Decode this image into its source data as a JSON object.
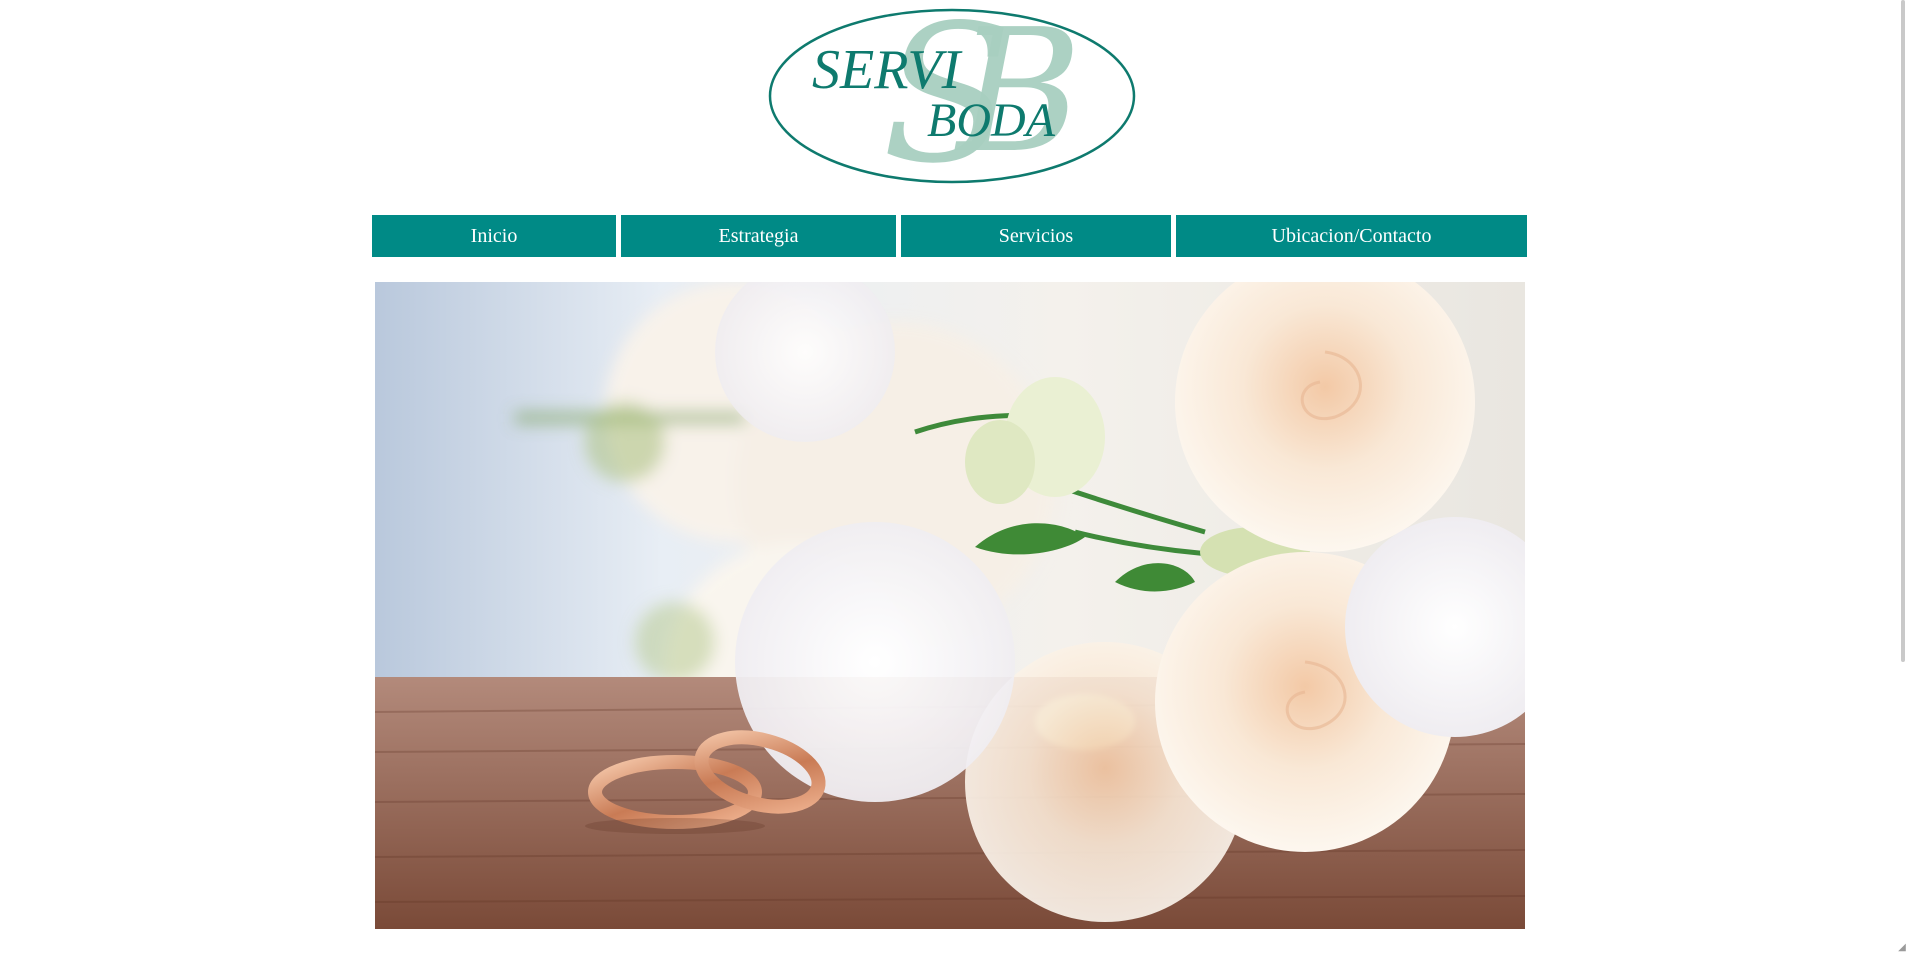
{
  "logo": {
    "line1": "SERVI",
    "line2": "BODA",
    "monogram": "SB",
    "colors": {
      "text": "#0e7a6e",
      "monogram": "#a8cfc0",
      "ellipse": "#0e7a6e"
    }
  },
  "nav": {
    "items": [
      {
        "label": "Inicio"
      },
      {
        "label": "Estrategia"
      },
      {
        "label": "Servicios"
      },
      {
        "label": "Ubicacion/Contacto"
      }
    ],
    "color": "#008a86",
    "text_color": "#ffffff"
  },
  "hero": {
    "subject": "wedding-rings-and-roses-photo"
  },
  "scrollbar": {
    "arrow_icon": "scroll-down-arrow-icon"
  }
}
